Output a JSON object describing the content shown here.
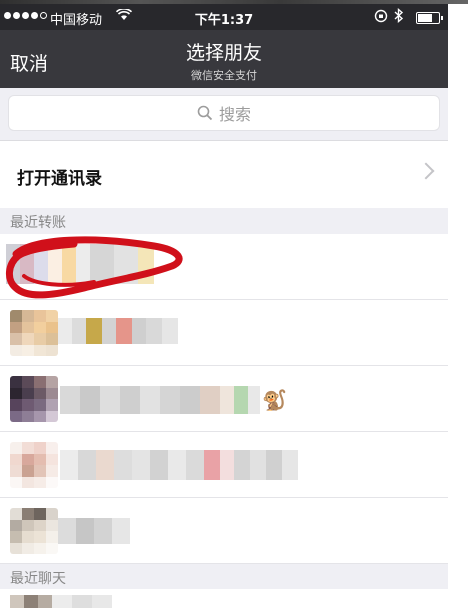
{
  "status_bar": {
    "carrier": "中国移动",
    "time": "下午1:37",
    "wifi_icon": "wifi-icon",
    "bluetooth_icon": "bluetooth-icon",
    "rotation_lock_icon": "rotation-lock-icon",
    "battery_level": 0.65
  },
  "nav": {
    "cancel_label": "取消",
    "title": "选择朋友",
    "subtitle": "微信安全支付"
  },
  "search": {
    "placeholder": "搜索",
    "icon": "search-icon"
  },
  "contacts_entry": {
    "label": "打开通讯录",
    "icon": "chevron-right-icon"
  },
  "sections": {
    "recent_transfer": "最近转账",
    "recent_chat": "最近聊天"
  },
  "recent_transfer_items": [
    {
      "name": "",
      "avatar": "pixelated-avatar",
      "annotation": "red-circle"
    },
    {
      "name": "",
      "avatar": "pixelated-avatar"
    },
    {
      "name": "",
      "avatar": "pixelated-avatar",
      "emoji": "🐒"
    },
    {
      "name": "",
      "avatar": "pixelated-avatar"
    },
    {
      "name": "",
      "avatar": "pixelated-avatar"
    }
  ],
  "colors": {
    "nav_bg": "#38383d",
    "status_bg": "#28282c",
    "group_bg": "#efeff4",
    "scribble": "#d0101a"
  }
}
